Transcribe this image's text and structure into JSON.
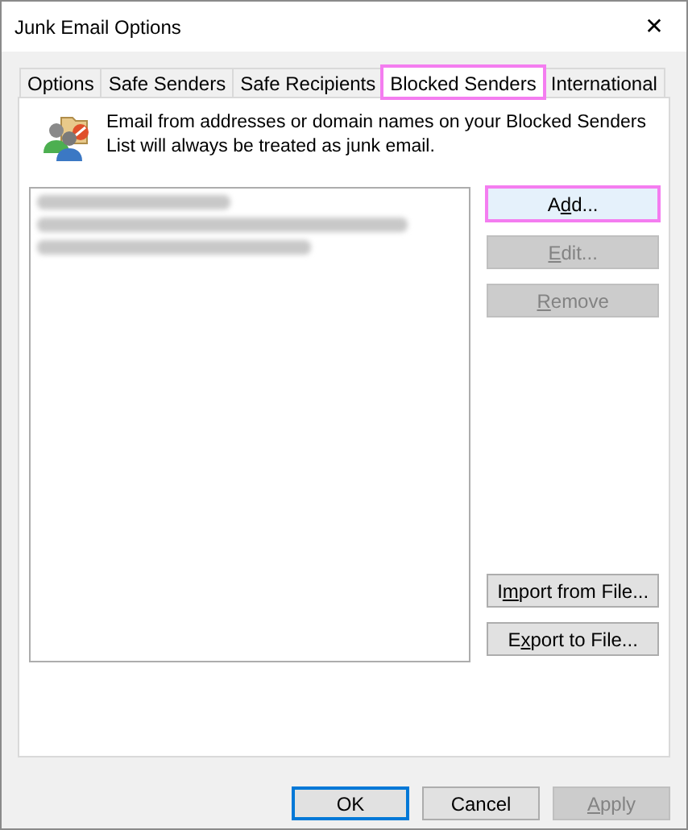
{
  "window": {
    "title": "Junk Email Options",
    "close": "✕"
  },
  "tabs": [
    {
      "label": "Options",
      "selected": false,
      "highlighted": false
    },
    {
      "label": "Safe Senders",
      "selected": false,
      "highlighted": false
    },
    {
      "label": "Safe Recipients",
      "selected": false,
      "highlighted": false
    },
    {
      "label": "Blocked Senders",
      "selected": true,
      "highlighted": true
    },
    {
      "label": "International",
      "selected": false,
      "highlighted": false
    }
  ],
  "description": "Email from addresses or domain names on your Blocked Senders List will always be treated as junk email.",
  "list": {
    "entries": [
      {
        "kind": "redacted"
      },
      {
        "kind": "redacted"
      },
      {
        "kind": "redacted"
      }
    ]
  },
  "top_buttons": [
    {
      "pre": "A",
      "key": "d",
      "post": "d...",
      "disabled": false,
      "highlighted": true
    },
    {
      "key": "E",
      "post": "dit...",
      "disabled": true,
      "highlighted": false
    },
    {
      "key": "R",
      "post": "emove",
      "disabled": true,
      "highlighted": false
    }
  ],
  "bottom_buttons": [
    {
      "pre": "I",
      "key": "m",
      "post": "port from File...",
      "disabled": false,
      "highlighted": false
    },
    {
      "pre": "E",
      "key": "x",
      "post": "port to File...",
      "disabled": false,
      "highlighted": false
    }
  ],
  "footer_buttons": [
    {
      "pre": "OK",
      "disabled": false,
      "default": true
    },
    {
      "pre": "Cancel",
      "disabled": false,
      "default": false
    },
    {
      "key": "A",
      "post": "pply",
      "disabled": true,
      "default": false
    }
  ]
}
